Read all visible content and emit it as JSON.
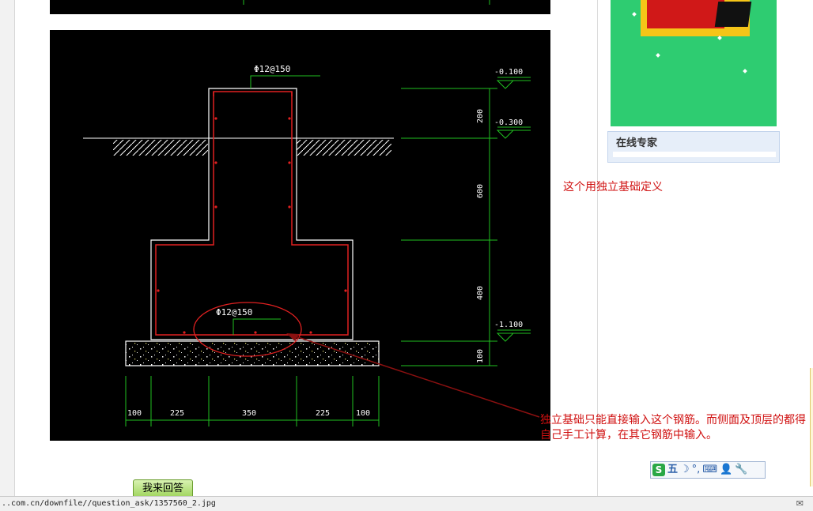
{
  "drawing": {
    "rebar_top_label": "Φ12@150",
    "rebar_bottom_label": "Φ12@150",
    "elevations": [
      "-0.100",
      "-0.300",
      "-1.100"
    ],
    "vertical_dims": [
      "200",
      "600",
      "400",
      "100"
    ],
    "horizontal_dims": [
      "100",
      "225",
      "350",
      "225",
      "100"
    ]
  },
  "sidebar": {
    "expert_title": "在线专家"
  },
  "annotations": {
    "note_top": "这个用独立基础定义",
    "note_bottom": "独立基础只能直接输入这个钢筋。而侧面及顶层的都得自己手工计算，在其它钢筋中输入。"
  },
  "ime": {
    "logo": "S",
    "mode": "五",
    "moon": "☽",
    "punct": "°,",
    "keyboard": "⌨",
    "user": "👤",
    "tool": "🔧"
  },
  "actions": {
    "reply_label": "我来回答"
  },
  "status": {
    "url": "..com.cn/downfile//question_ask/1357560_2.jpg",
    "icon": "✉"
  },
  "colors": {
    "cad_bg": "#000000",
    "rebar": "#e02020",
    "dim": "#20c020",
    "concrete": "#ffffff",
    "accent_text": "#d01010",
    "ad_green": "#2ecc71"
  }
}
